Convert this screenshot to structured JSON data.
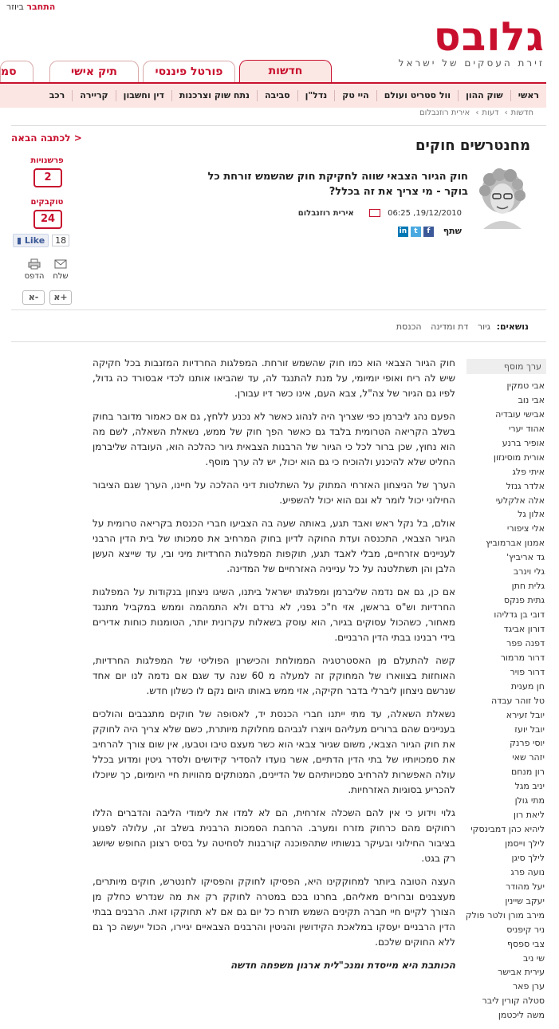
{
  "top": {
    "register": "ביוזר",
    "login": "התחבר"
  },
  "logo": {
    "word": "גלובס",
    "tagline": "זירת העסקים של ישראל"
  },
  "tabs": [
    {
      "label": "חדשות"
    },
    {
      "label": "פורטל פיננסי"
    },
    {
      "label": "תיק אישי"
    },
    {
      "label": "סמ"
    }
  ],
  "nav": [
    "ראשי",
    "שוק ההון",
    "וול סטריט ועולם",
    "היי טק",
    "נדל\"ן",
    "סביבה",
    "נתח שוק וצרכנות",
    "דין וחשבון",
    "קריירה",
    "רכב"
  ],
  "breadcrumb": [
    "חדשות",
    "דעות",
    "אירית רוזנבלום"
  ],
  "next_article": "לכתבה הבאה >",
  "title": "מחנטרשים חוקים",
  "subtitle": "חוק הגיור הצבאי שווה לחקיקת חוק שהשמש זורחת כל בוקר - מי צריך את זה בכלל?",
  "meta": {
    "date": "19/12/2010, 06:25",
    "author": "אירית רוזנבלום"
  },
  "share": {
    "label": "שתף"
  },
  "widgets": {
    "comments_label": "פרשנויות",
    "comments_count": "2",
    "talkbacks_label": "טוקבקים",
    "talkbacks_count": "24",
    "like_label": "Like",
    "like_count": "18",
    "print_label": "הדפס",
    "send_label": "שלח",
    "font_up": "א+",
    "font_down": "א-"
  },
  "topics": {
    "label": "נושאים:",
    "items": [
      "גיור",
      "דת ומדינה",
      "הכנסת"
    ]
  },
  "sidebar": {
    "head": "ערך מוסף",
    "items": [
      "אבי טמקין",
      "אבי נוב",
      "אבישי עובדיה",
      "אהוד יערי",
      "אופיר ברנע",
      "אורית מוסינזון",
      "איתי פלג",
      "אלדר גנזל",
      "אלה אלקלעי",
      "אלון גל",
      "אלי ציפורי",
      "אמנון אברמוביץ",
      "גד אריביץ'",
      "גלי וינרב",
      "גלית חתן",
      "גתית פנקס",
      "דובי בן גדליהו",
      "דורון אביגד",
      "דפנה פפר",
      "דרור מרמור",
      "דרור פויר",
      "חן מענית",
      "טל זוהר עבדה",
      "יובל זעירא",
      "יובל יועז",
      "יוסי פרנק",
      "יזהר שאי",
      "רון מנחם",
      "יניב מגל",
      "מתי גולן",
      "ליאת רון",
      "ליהיא כהן דמבינסקי",
      "לילך וייסמן",
      "לילך סיגן",
      "נועה פרג",
      "יעל מהודר",
      "יעקב שיינין",
      "מירב מורן ולטר פולק",
      "ניר קיפניס",
      "צבי ספסף",
      "שי ניב",
      "עירית אבישר",
      "ערן פאר",
      "סטלה קורין ליבר",
      "משה ליכטמן"
    ]
  },
  "body": [
    "חוק הגיור הצבאי הוא כמו חוק שהשמש זורחת. המפלגות החרדיות המזנבות בכל חקיקה שיש לה ריח ואופי יומיומי, על מנת להתנגד לה, עד שהביאו אותנו לכדי אבסורד כה גדול, לפיו גם הגיור של צה\"ל, צבא העם, אינו כשר דיו עבורן.",
    "הפעם נהג ליברמן כפי שצריך היה לנהוג כאשר לא נכנע ללחץ, גם אם כאמור מדובר בחוק בשלב הקריאה הטרומית בלבד גם כאשר הפך חוק של ממש, נשאלת השאלה, לשם מה הוא נחוץ, שכן ברור לכל כי הגיור של הרבנות הצבאית גיור כהלכה הוא, העובדה שליברמן החליט שלא להיכנע ולהוכיח כי גם הוא יכול, יש לה ערך מוסף.",
    "הערך של הניצחון האזרחי המתוק על השתלטות דיני ההלכה על חיינו, הערך שגם הציבור החילוני יכול לומר לא וגם הוא יכול להשפיע.",
    "אולם, בל נקל ראש ואבד תגע, באותה שעה בה הצביעו חברי הכנסת בקריאה טרומית על הגיור הצבאי, התכנסה ועדת החוקה לדיון בחוק המרחיב את סמכותו של בית הדין הרבני לעניינים אזרחיים, מבלי לאבד תגע, תוקפות המפלגות החרדיות מיני ובי, עד שייצא העשן הלבן והן תשתלטנה על כל ענייניה האזרחיים של המדינה.",
    "אם כן, גם אם נדמה שליברמן ומפלגתו ישראל ביתנו, השיגו ניצחון בנקודות על המפלגות החרדיות וש\"ס בראשן, אזי ח\"כ גפני, לא נרדם ולא התמהמה וממש במקביל מתנגד מאחור, כשהכול עסוקים בגיור, הוא עוסק בשאלות עקרונית יותר, הטומנות כוחות אדירים בידי רבנינו בבתי הדין הרבניים.",
    "קשה להתעלם מן האסטרטגיה הממולחת והכישרון הפוליטי של המפלגות החרדיות, האוחזות בצווארו של המחוקק זה למעלה מ 60 שנה עד שגם אם נדמה לנו יום אחד שנרשם ניצחון ליברלי בדבר חקיקה, אזי ממש באותו היום נקם לו כשלון חדש.",
    "נשאלת השאלה, עד מתי ייתנו חברי הכנסת יד, לאסופה של חוקים מתגבבים והולכים בעניינים שהם ברורים מעליהם ויוצרו לגביהם מחלוקת מיותרת, כשם שלא צריך היה לחוקק את חוק הגיור הצבאי, משום שגיור צבאי הוא כשר מעצם טיבו וטבעו, אין שום צורך להרחיב את סמכויותיו של בתי הדין הדתיים, אשר נועדו להסדיר קידושים ולסדר גיטין ומדוע בכלל עולה האפשרות להרחיב סמכויותיהם של הדיינים, המנותקים מהוויות חיי היומיום, כך שיוכלו להכריע בסוגיות האזרחיות.",
    "גלוי וידוע כי אין להם השכלה אזרחית, הם לא למדו את לימודי הליבה והדברים הללו רחוקים מהם כרחוק מזרח ומערב. הרחבת הסמכות הרבנית בשלב זה, עלולה לפגוע בציבור החילוני ובעיקר בנשותיו שתהפוכנה קורבנות לסחיטה על בסיס רצונן החופש שיושג רק בגט.",
    "העצה הטובה ביותר למחוקקינו היא, הפסיקו לחוקק והפסיקו לחנטרש, חוקים מיותרים, מעצבנים וברורים מאליהם, בחרנו בכם במטרה לחוקק רק את מה שנדרש כחלק מן הצורך לקיים חיי חברה תקינים השמש תזרח כל יום גם אם לא תחוקקו זאת. הרבנים בבתי הדין הרבניים יעסקו במלאכת הקידושין והגיטין והרבנים הצבאיים יגיירו, הכול ייעשה כך גם ללא החוקים שלכם."
  ],
  "signature": "הכותבת היא מייסדת ומנכ\"לית ארגון משפחה חדשה"
}
